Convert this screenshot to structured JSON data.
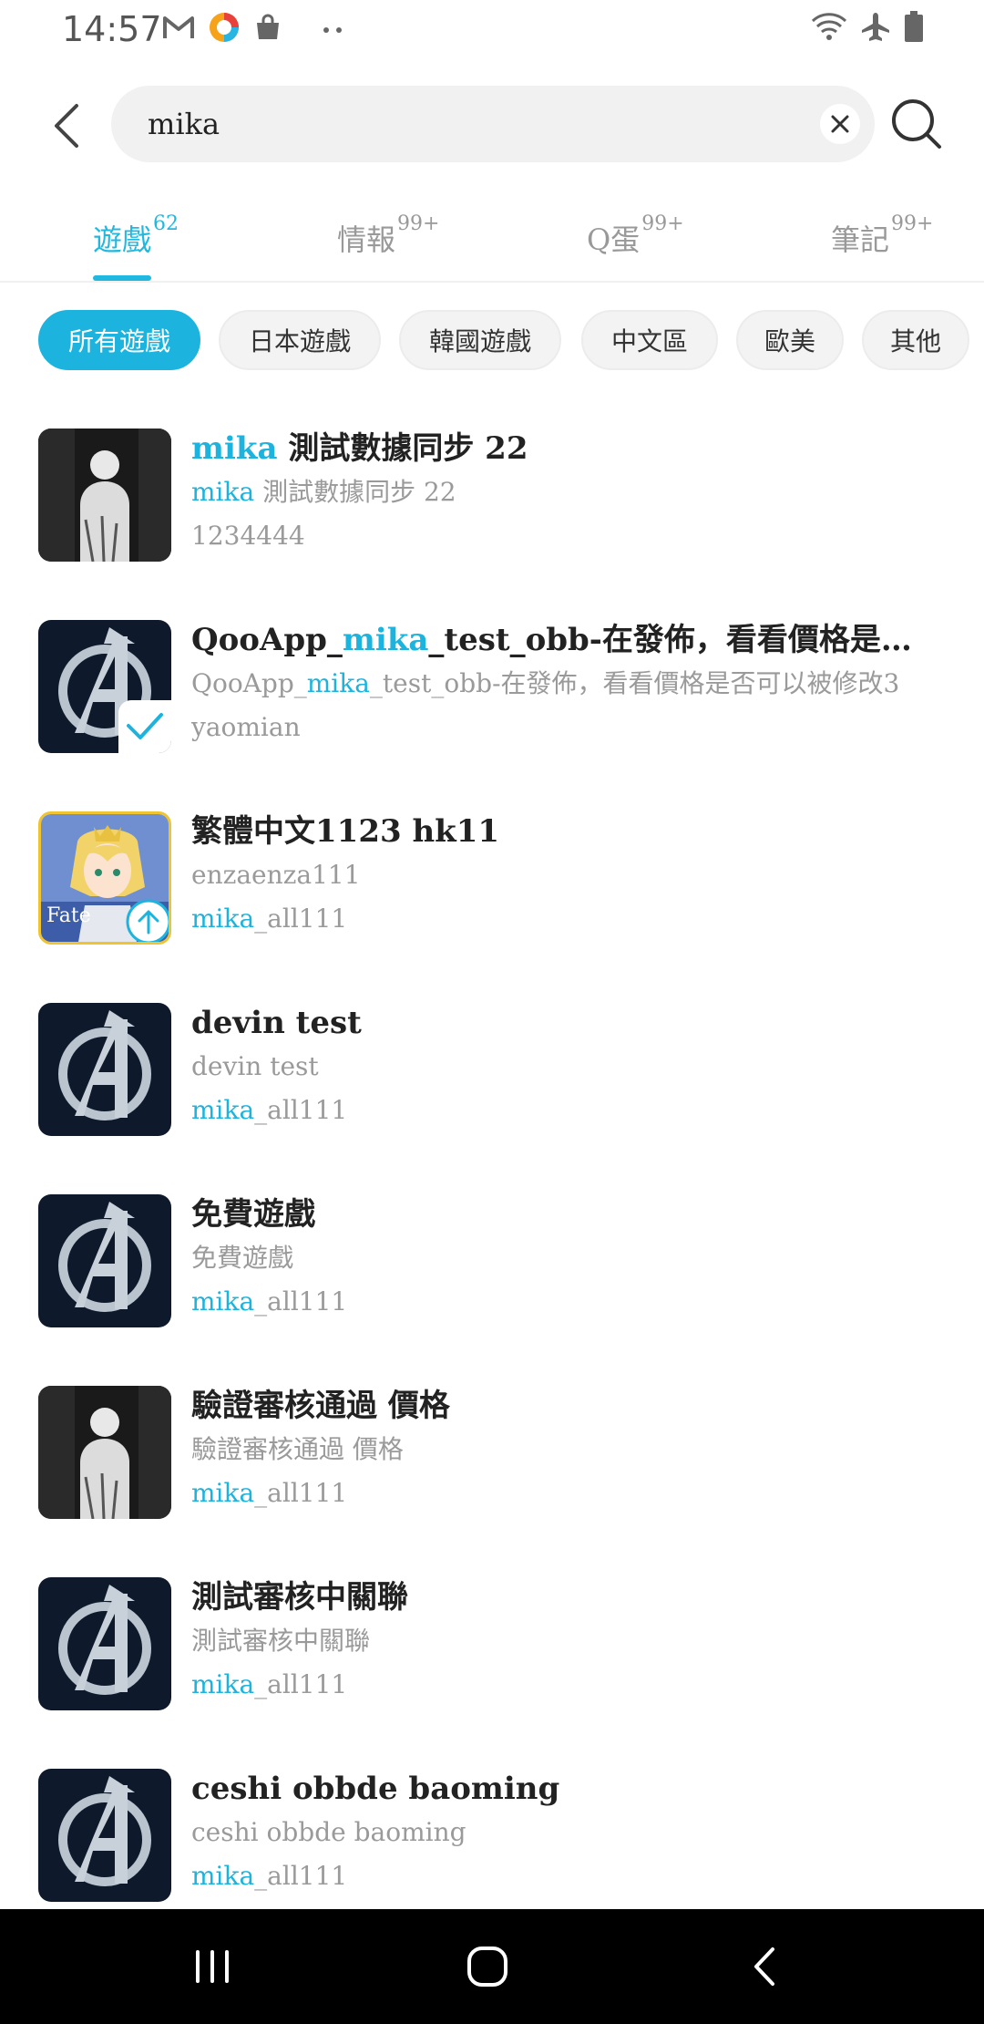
{
  "status": {
    "time": "14:57",
    "left_icons": [
      "gmail-icon",
      "qooapp-icon",
      "bag-icon",
      "more-dots-icon"
    ],
    "right_icons": [
      "wifi-icon",
      "airplane-icon",
      "battery-icon"
    ]
  },
  "search": {
    "query": "mika"
  },
  "tabs": [
    {
      "label": "遊戲",
      "count": "62",
      "active": true
    },
    {
      "label": "情報",
      "count": "99+",
      "active": false
    },
    {
      "label": "Q蛋",
      "count": "99+",
      "active": false
    },
    {
      "label": "筆記",
      "count": "99+",
      "active": false
    }
  ],
  "filters": [
    {
      "label": "所有遊戲",
      "active": true
    },
    {
      "label": "日本遊戲",
      "active": false
    },
    {
      "label": "韓國遊戲",
      "active": false
    },
    {
      "label": "中文區",
      "active": false
    },
    {
      "label": "歐美",
      "active": false
    },
    {
      "label": "其他",
      "active": false
    }
  ],
  "results": [
    {
      "icon": "silhouette",
      "badge": "",
      "title_pre": "",
      "title_hl": "mika",
      "title_post": " 測試數據同步 22",
      "line2_pre": "",
      "line2_hl": "mika",
      "line2_post": " 測試數據同步 22",
      "line3_pre": "1234444",
      "line3_hl": "",
      "line3_post": ""
    },
    {
      "icon": "avengers",
      "badge": "check",
      "title_pre": "QooApp_",
      "title_hl": "mika",
      "title_post": "_test_obb-在發佈，看看價格是否可..",
      "line2_pre": "QooApp_",
      "line2_hl": "mika",
      "line2_post": "_test_obb-在發佈，看看價格是否可以被修改3",
      "line3_pre": "yaomian",
      "line3_hl": "",
      "line3_post": ""
    },
    {
      "icon": "fate",
      "badge": "upload",
      "title_pre": "繁體中文1123 hk11",
      "title_hl": "",
      "title_post": "",
      "line2_pre": "enzaenza111",
      "line2_hl": "",
      "line2_post": "",
      "line3_pre": "",
      "line3_hl": "mika",
      "line3_post": "_all111"
    },
    {
      "icon": "avengers",
      "badge": "",
      "title_pre": "devin test",
      "title_hl": "",
      "title_post": "",
      "line2_pre": "devin test",
      "line2_hl": "",
      "line2_post": "",
      "line3_pre": "",
      "line3_hl": "mika",
      "line3_post": "_all111"
    },
    {
      "icon": "avengers",
      "badge": "",
      "title_pre": "免費遊戲",
      "title_hl": "",
      "title_post": "",
      "line2_pre": "免費遊戲",
      "line2_hl": "",
      "line2_post": "",
      "line3_pre": "",
      "line3_hl": "mika",
      "line3_post": "_all111"
    },
    {
      "icon": "silhouette",
      "badge": "",
      "title_pre": "驗證審核通過 價格",
      "title_hl": "",
      "title_post": "",
      "line2_pre": "驗證審核通過 價格",
      "line2_hl": "",
      "line2_post": "",
      "line3_pre": "",
      "line3_hl": "mika",
      "line3_post": "_all111"
    },
    {
      "icon": "avengers",
      "badge": "",
      "title_pre": "測試審核中關聯",
      "title_hl": "",
      "title_post": "",
      "line2_pre": "測試審核中關聯",
      "line2_hl": "",
      "line2_post": "",
      "line3_pre": "",
      "line3_hl": "mika",
      "line3_post": "_all111"
    },
    {
      "icon": "avengers",
      "badge": "",
      "title_pre": "ceshi obbde baoming",
      "title_hl": "",
      "title_post": "",
      "line2_pre": "ceshi obbde baoming",
      "line2_hl": "",
      "line2_post": "",
      "line3_pre": "",
      "line3_hl": "mika",
      "line3_post": "_all111"
    }
  ],
  "colors": {
    "accent": "#1cb4de",
    "nav_bar": "#000000",
    "chip_bg": "#f3f3f3"
  }
}
